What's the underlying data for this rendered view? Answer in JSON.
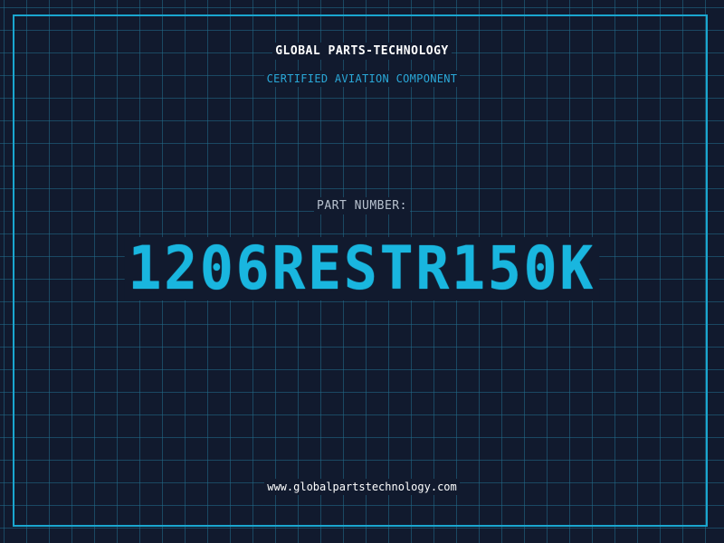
{
  "header": {
    "brand": "GLOBAL PARTS-TECHNOLOGY",
    "subtitle": "CERTIFIED AVIATION COMPONENT"
  },
  "part": {
    "label": "PART NUMBER:",
    "number": "1206RESTR150K"
  },
  "footer": {
    "url": "www.globalpartstechnology.com"
  },
  "colors": {
    "background": "#111a2e",
    "grid": "#226e8c",
    "accent": "#19b6df",
    "frame": "#1aa6cf"
  }
}
